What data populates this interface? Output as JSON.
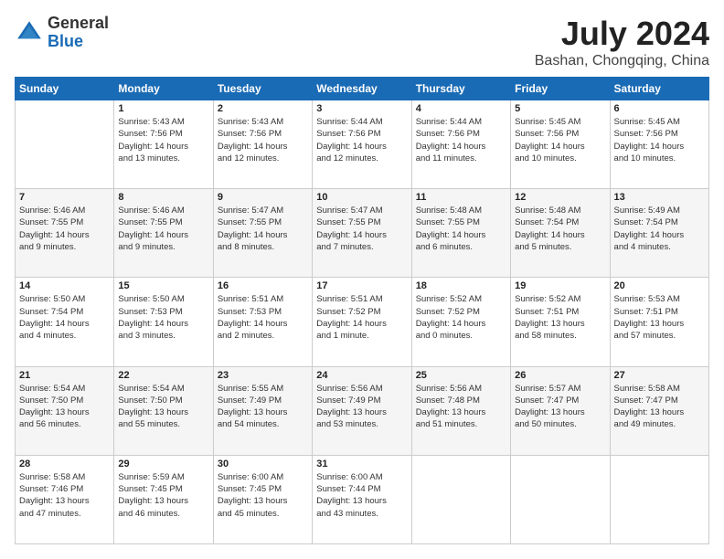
{
  "logo": {
    "general": "General",
    "blue": "Blue"
  },
  "title": "July 2024",
  "location": "Bashan, Chongqing, China",
  "days_of_week": [
    "Sunday",
    "Monday",
    "Tuesday",
    "Wednesday",
    "Thursday",
    "Friday",
    "Saturday"
  ],
  "weeks": [
    [
      {
        "day": "",
        "info": ""
      },
      {
        "day": "1",
        "info": "Sunrise: 5:43 AM\nSunset: 7:56 PM\nDaylight: 14 hours\nand 13 minutes."
      },
      {
        "day": "2",
        "info": "Sunrise: 5:43 AM\nSunset: 7:56 PM\nDaylight: 14 hours\nand 12 minutes."
      },
      {
        "day": "3",
        "info": "Sunrise: 5:44 AM\nSunset: 7:56 PM\nDaylight: 14 hours\nand 12 minutes."
      },
      {
        "day": "4",
        "info": "Sunrise: 5:44 AM\nSunset: 7:56 PM\nDaylight: 14 hours\nand 11 minutes."
      },
      {
        "day": "5",
        "info": "Sunrise: 5:45 AM\nSunset: 7:56 PM\nDaylight: 14 hours\nand 10 minutes."
      },
      {
        "day": "6",
        "info": "Sunrise: 5:45 AM\nSunset: 7:56 PM\nDaylight: 14 hours\nand 10 minutes."
      }
    ],
    [
      {
        "day": "7",
        "info": "Sunrise: 5:46 AM\nSunset: 7:55 PM\nDaylight: 14 hours\nand 9 minutes."
      },
      {
        "day": "8",
        "info": "Sunrise: 5:46 AM\nSunset: 7:55 PM\nDaylight: 14 hours\nand 9 minutes."
      },
      {
        "day": "9",
        "info": "Sunrise: 5:47 AM\nSunset: 7:55 PM\nDaylight: 14 hours\nand 8 minutes."
      },
      {
        "day": "10",
        "info": "Sunrise: 5:47 AM\nSunset: 7:55 PM\nDaylight: 14 hours\nand 7 minutes."
      },
      {
        "day": "11",
        "info": "Sunrise: 5:48 AM\nSunset: 7:55 PM\nDaylight: 14 hours\nand 6 minutes."
      },
      {
        "day": "12",
        "info": "Sunrise: 5:48 AM\nSunset: 7:54 PM\nDaylight: 14 hours\nand 5 minutes."
      },
      {
        "day": "13",
        "info": "Sunrise: 5:49 AM\nSunset: 7:54 PM\nDaylight: 14 hours\nand 4 minutes."
      }
    ],
    [
      {
        "day": "14",
        "info": "Sunrise: 5:50 AM\nSunset: 7:54 PM\nDaylight: 14 hours\nand 4 minutes."
      },
      {
        "day": "15",
        "info": "Sunrise: 5:50 AM\nSunset: 7:53 PM\nDaylight: 14 hours\nand 3 minutes."
      },
      {
        "day": "16",
        "info": "Sunrise: 5:51 AM\nSunset: 7:53 PM\nDaylight: 14 hours\nand 2 minutes."
      },
      {
        "day": "17",
        "info": "Sunrise: 5:51 AM\nSunset: 7:52 PM\nDaylight: 14 hours\nand 1 minute."
      },
      {
        "day": "18",
        "info": "Sunrise: 5:52 AM\nSunset: 7:52 PM\nDaylight: 14 hours\nand 0 minutes."
      },
      {
        "day": "19",
        "info": "Sunrise: 5:52 AM\nSunset: 7:51 PM\nDaylight: 13 hours\nand 58 minutes."
      },
      {
        "day": "20",
        "info": "Sunrise: 5:53 AM\nSunset: 7:51 PM\nDaylight: 13 hours\nand 57 minutes."
      }
    ],
    [
      {
        "day": "21",
        "info": "Sunrise: 5:54 AM\nSunset: 7:50 PM\nDaylight: 13 hours\nand 56 minutes."
      },
      {
        "day": "22",
        "info": "Sunrise: 5:54 AM\nSunset: 7:50 PM\nDaylight: 13 hours\nand 55 minutes."
      },
      {
        "day": "23",
        "info": "Sunrise: 5:55 AM\nSunset: 7:49 PM\nDaylight: 13 hours\nand 54 minutes."
      },
      {
        "day": "24",
        "info": "Sunrise: 5:56 AM\nSunset: 7:49 PM\nDaylight: 13 hours\nand 53 minutes."
      },
      {
        "day": "25",
        "info": "Sunrise: 5:56 AM\nSunset: 7:48 PM\nDaylight: 13 hours\nand 51 minutes."
      },
      {
        "day": "26",
        "info": "Sunrise: 5:57 AM\nSunset: 7:47 PM\nDaylight: 13 hours\nand 50 minutes."
      },
      {
        "day": "27",
        "info": "Sunrise: 5:58 AM\nSunset: 7:47 PM\nDaylight: 13 hours\nand 49 minutes."
      }
    ],
    [
      {
        "day": "28",
        "info": "Sunrise: 5:58 AM\nSunset: 7:46 PM\nDaylight: 13 hours\nand 47 minutes."
      },
      {
        "day": "29",
        "info": "Sunrise: 5:59 AM\nSunset: 7:45 PM\nDaylight: 13 hours\nand 46 minutes."
      },
      {
        "day": "30",
        "info": "Sunrise: 6:00 AM\nSunset: 7:45 PM\nDaylight: 13 hours\nand 45 minutes."
      },
      {
        "day": "31",
        "info": "Sunrise: 6:00 AM\nSunset: 7:44 PM\nDaylight: 13 hours\nand 43 minutes."
      },
      {
        "day": "",
        "info": ""
      },
      {
        "day": "",
        "info": ""
      },
      {
        "day": "",
        "info": ""
      }
    ]
  ]
}
